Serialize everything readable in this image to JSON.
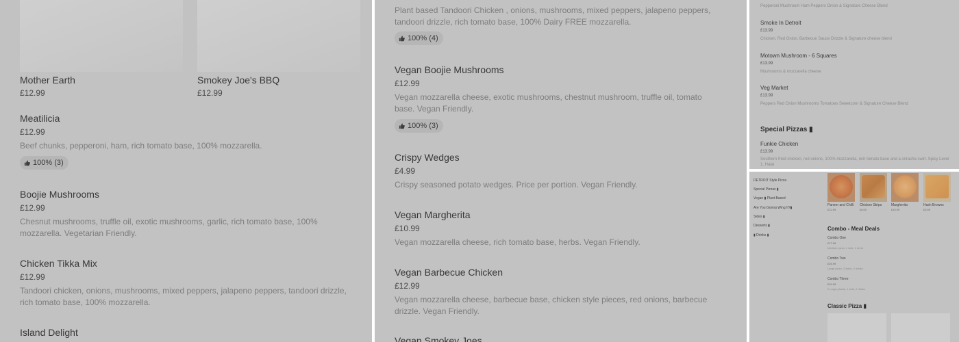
{
  "panel1": {
    "cards": [
      {
        "name": "Mother Earth",
        "price": "£12.99"
      },
      {
        "name": "Smokey Joe's BBQ",
        "price": "£12.99"
      }
    ],
    "items": [
      {
        "name": "Meatilicia",
        "price": "£12.99",
        "desc": "Beef chunks, pepperoni, ham, rich tomato base, 100% mozzarella.",
        "rating": "100% (3)"
      },
      {
        "name": "Boojie Mushrooms",
        "price": "£12.99",
        "desc": "Chesnut mushrooms, truffle oil, exotic mushrooms, garlic, rich tomato base, 100% mozzarella. Vegetarian Friendly."
      },
      {
        "name": "Chicken Tikka Mix",
        "price": "£12.99",
        "desc": "Tandoori chicken, onions, mushrooms, mixed peppers, jalapeno peppers, tandoori drizzle, rich tomato base, 100% mozzarella."
      },
      {
        "name": "Island Delight"
      }
    ]
  },
  "panel2": {
    "items": [
      {
        "desc": "Plant based Tandoori Chicken , onions, mushrooms, mixed peppers, jalapeno peppers, tandoori drizzle, rich tomato base, 100% Dairy FREE mozzarella.",
        "rating": "100% (4)"
      },
      {
        "name": "Vegan Boojie Mushrooms",
        "price": "£12.99",
        "desc": "Vegan mozzarella cheese, exotic mushrooms, chestnut mushroom, truffle oil, tomato base. Vegan Friendly.",
        "rating": "100% (3)"
      },
      {
        "name": "Crispy Wedges",
        "price": "£4.99",
        "desc": "Crispy seasoned potato wedges. Price per portion. Vegan Friendly."
      },
      {
        "name": "Vegan Margherita",
        "price": "£10.99",
        "desc": "Vegan mozzarella cheese, rich tomato base, herbs. Vegan Friendly."
      },
      {
        "name": "Vegan Barbecue Chicken",
        "price": "£12.99",
        "desc": "Vegan mozzarella cheese, barbecue base, chicken style pieces, red onions, barbecue drizzle. Vegan Friendly."
      },
      {
        "name": "Vegan Smokey Joes"
      }
    ]
  },
  "panel3": {
    "top_desc": "Pepperoni Mushroom Ham Peppers Onion & Signature Cheese Blend",
    "items": [
      {
        "name": "Smoke In Detroit",
        "price": "£13.99",
        "desc": "Chicken, Red Onion, Barbecue Sauce Drizzle & Signature cheese blend"
      },
      {
        "name": "Motown Mushroom - 6 Squares",
        "price": "£13.99",
        "desc": "Mushrooms & mozzarella cheese"
      },
      {
        "name": "Veg Market",
        "price": "£13.99",
        "desc": "Peppers Red Onion Mushrooms Tomatoes Sweetcorn & Signature Cheese Blend"
      }
    ],
    "section_heading": "Special Pizzas ▮",
    "section_item": {
      "name": "Funkie Chicken",
      "price": "£13.99",
      "desc": "Southern fried chicken, red onions, 100% mozzarella, rich tomato base and a sriracha swirl. Spicy Level 1. Halal"
    }
  },
  "panel4": {
    "nav": [
      "DETROIT Style Pizza",
      "Special Pizzas ▮",
      "Vegan ▮ Plant Based",
      "Are You Gonna Wing It?▮",
      "Sides ▮",
      "Desserts ▮",
      "▮ Drinks ▮"
    ],
    "tiles": [
      {
        "name": "Paneer and Chilli",
        "price": "£12.99"
      },
      {
        "name": "Chicken Strips",
        "price": "£8.00"
      },
      {
        "name": "Margherita",
        "price": "£10.99"
      },
      {
        "name": "Hash Browns",
        "price": "£3.99"
      }
    ],
    "combo_heading": "Combo - Meal Deals",
    "combos": [
      {
        "name": "Combo One",
        "price": "£17.99",
        "desc": "Medium pizza, 1 side, 1 drink"
      },
      {
        "name": "Combo Two",
        "price": "£26.99",
        "desc": "Large pizza, 2 sides, 2 drinks"
      },
      {
        "name": "Combo Three",
        "price": "£34.99",
        "desc": "2 Large pizzas, 1 side, 2 drinks"
      }
    ],
    "classic_heading": "Classic Pizza ▮"
  },
  "colors": {
    "overlay": "#c2c2c2",
    "badge": "#b6b6b6",
    "divider": "#ffffff"
  },
  "icons": {
    "rating": "thumbs-up-icon"
  }
}
